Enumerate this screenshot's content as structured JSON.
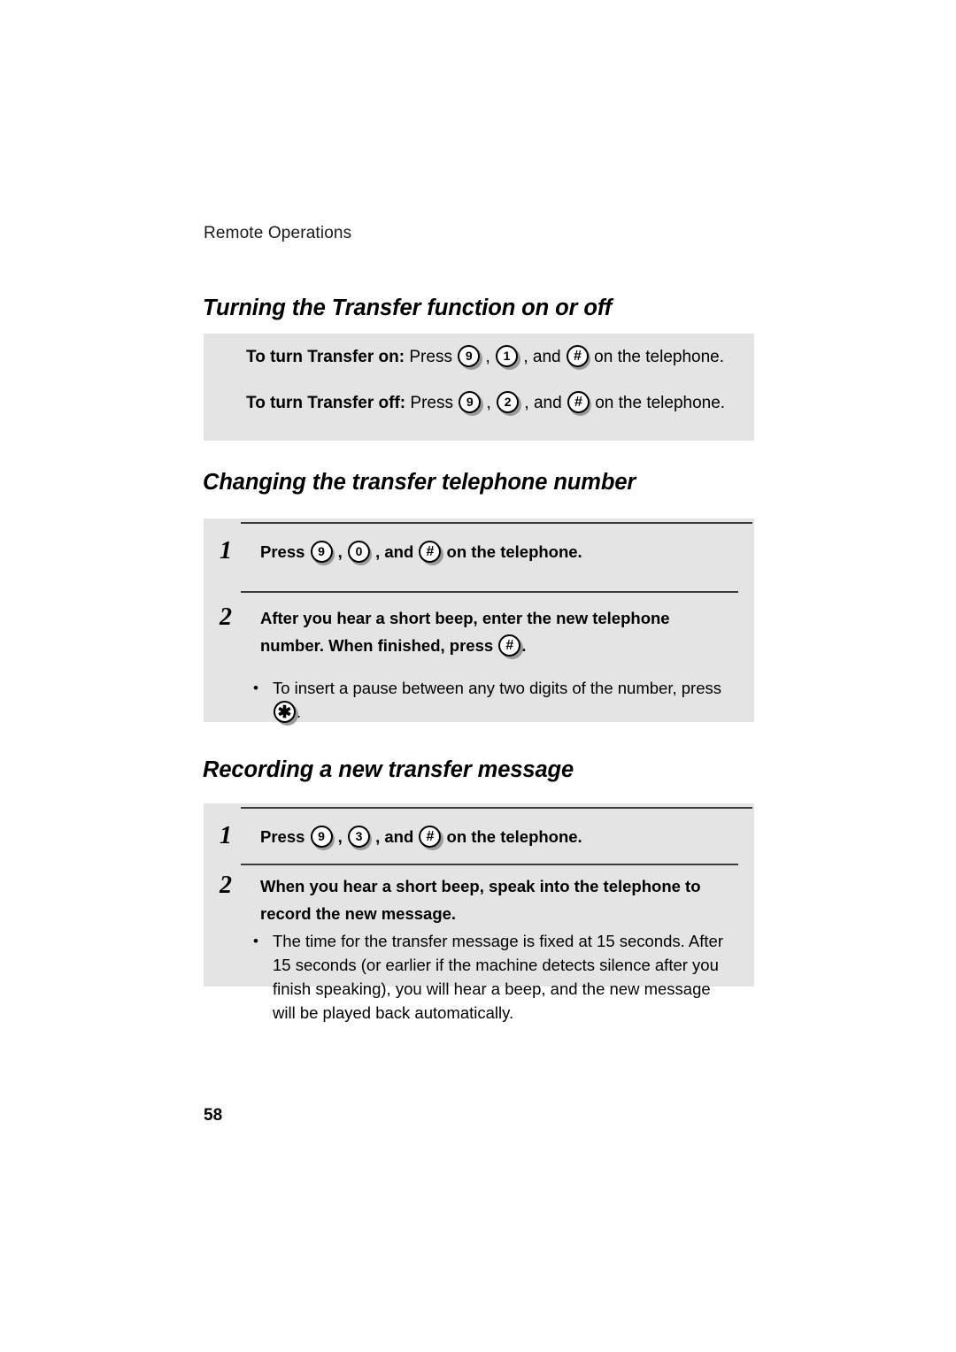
{
  "page": {
    "running_head": "Remote Operations",
    "folio": "58",
    "panel_bg": "#e4e4e4",
    "text_color": "#000000"
  },
  "sections": [
    {
      "id": "transfer",
      "heading": "Turning the Transfer function on or off",
      "lines": [
        {
          "lead": "To turn Transfer on:",
          "before": " Press ",
          "key1": "9",
          "sep1": " , ",
          "key2": "1",
          "sep2": " , and ",
          "key3": "#",
          "after": " on the telephone."
        },
        {
          "lead": "To turn Transfer off:",
          "before": " Press ",
          "key1": "9",
          "sep1": " , ",
          "key2": "2",
          "sep2": " , and ",
          "key3": "#",
          "after": " on the telephone."
        }
      ]
    },
    {
      "id": "changing",
      "heading": "Changing the transfer telephone number",
      "step1": {
        "num": "1",
        "before": "Press ",
        "key1": "9",
        "sep1": " , ",
        "key2": "0",
        "sep2": " , and ",
        "key3": "#",
        "after": " on the telephone."
      },
      "step2": {
        "num": "2",
        "text_a": "After you hear a short beep, enter the new telephone number. When finished, press ",
        "key": "#",
        "text_b": ".",
        "note": {
          "bullet": "•",
          "text_a": "To insert a pause between any two digits of the number, press ",
          "key": "✱",
          "text_b": "."
        }
      }
    },
    {
      "id": "recording",
      "heading": "Recording a new transfer message",
      "step1": {
        "num": "1",
        "before": "Press ",
        "key1": "9",
        "sep1": " , ",
        "key2": "3",
        "sep2": " , and ",
        "key3": "#",
        "after": " on the telephone."
      },
      "step2": {
        "num": "2",
        "text_a": "When you hear a short beep, speak into the telephone to record the new message.",
        "note": {
          "bullet": "•",
          "text_a": "The time for the transfer message is fixed at 15 seconds. After 15 seconds (or earlier if the machine detects silence after you finish speaking), you will hear a beep, and the new message will be played back automatically."
        }
      }
    }
  ]
}
